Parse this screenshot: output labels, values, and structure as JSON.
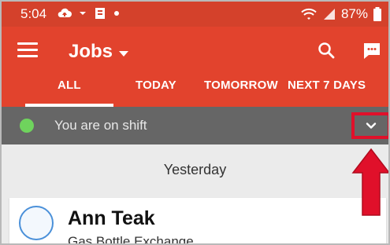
{
  "status_bar": {
    "time": "5:04",
    "battery": "87%"
  },
  "app_bar": {
    "title": "Jobs",
    "icons": [
      "menu-icon",
      "search-icon",
      "chat-icon"
    ]
  },
  "tabs": [
    {
      "label": "ALL",
      "selected": true
    },
    {
      "label": "TODAY",
      "selected": false
    },
    {
      "label": "TOMORROW",
      "selected": false
    },
    {
      "label": "NEXT 7 DAYS",
      "selected": false
    }
  ],
  "shift": {
    "status_text": "You are on shift",
    "status_color": "#6fd35d"
  },
  "jobs_list": {
    "section_header": "Yesterday",
    "items": [
      {
        "name": "Ann Teak",
        "subtitle": "Gas Bottle Exchange"
      }
    ]
  },
  "colors": {
    "app_bar": "#e2432d",
    "status_bar": "#d4412b",
    "shift_bar": "#666666",
    "highlight": "#e0102a"
  }
}
